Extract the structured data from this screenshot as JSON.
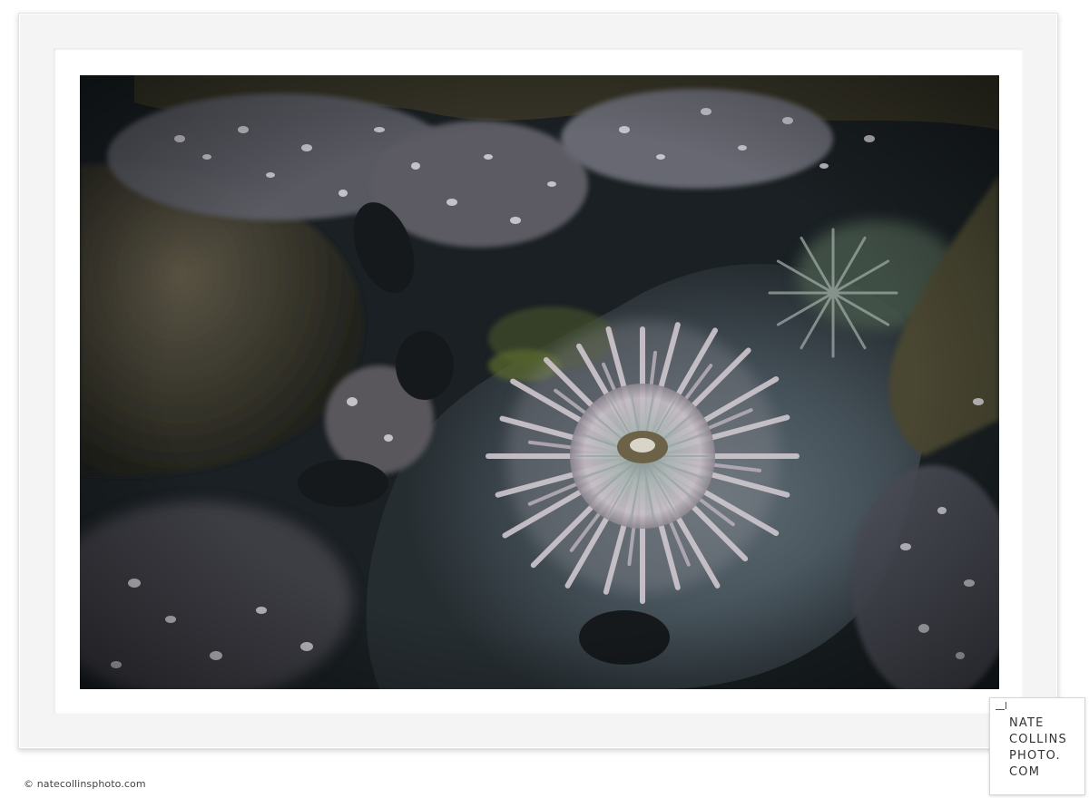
{
  "copyright": "© natecollinsphoto.com",
  "logo": {
    "lines": [
      "NATE",
      "COLLINS",
      "PHOTO.",
      "COM"
    ]
  },
  "photo": {
    "subject": "sea anemone in tide pool",
    "palette": {
      "water": "#3f4b53",
      "rock": "#3b3a2f",
      "anemone": "#c9c3c8",
      "shell": "#d7d5dc",
      "dark": "#141a1e"
    }
  }
}
